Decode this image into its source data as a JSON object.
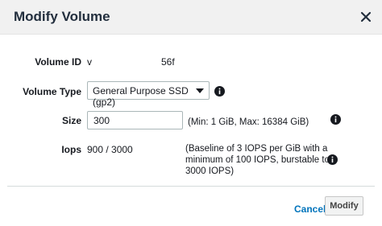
{
  "dialog": {
    "title": "Modify Volume",
    "close_icon": "close-icon"
  },
  "fields": {
    "volume_id": {
      "label": "Volume ID",
      "value_prefix": "v",
      "value_suffix": "56f"
    },
    "volume_type": {
      "label": "Volume Type",
      "selected": "General Purpose SSD (gp2)",
      "info_icon": "info-icon"
    },
    "size": {
      "label": "Size",
      "value": "300",
      "hint": "(Min: 1 GiB, Max: 16384 GiB)",
      "info_icon": "info-icon"
    },
    "iops": {
      "label": "Iops",
      "value": "900 / 3000",
      "hint_line1": "(Baseline of 3 IOPS per GiB with a",
      "hint_line2": "minimum of 100 IOPS, burstable to",
      "hint_line3": "3000 IOPS)",
      "info_icon": "info-icon"
    }
  },
  "footer": {
    "cancel_label": "Cancel",
    "modify_label": "Modify"
  },
  "colors": {
    "link": "#0073bb",
    "header_bg": "#f1f1f1"
  }
}
